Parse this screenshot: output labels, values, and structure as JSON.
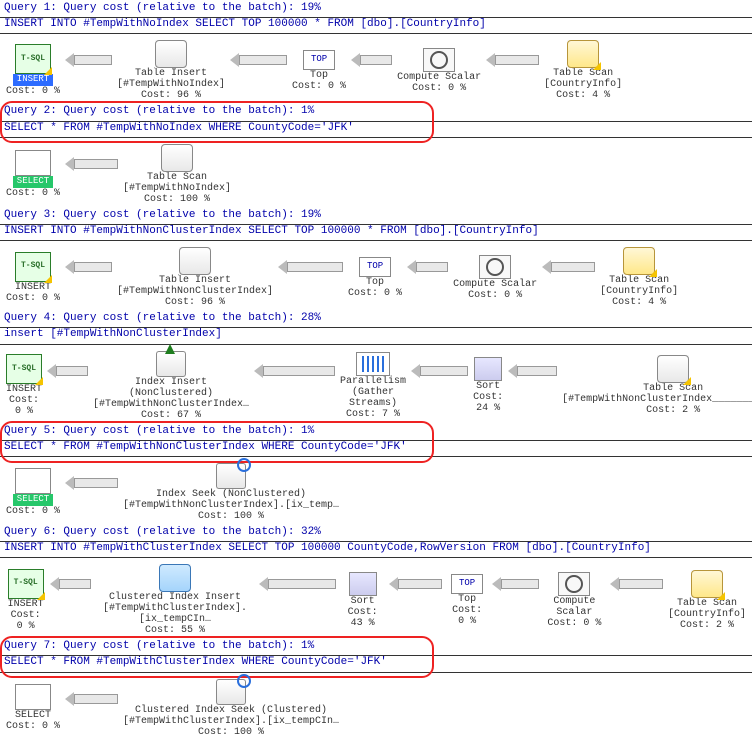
{
  "queries": [
    {
      "title": "Query 1: Query cost (relative to the batch): 19%",
      "sql": "INSERT INTO #TempWithNoIndex SELECT TOP 100000 * FROM [dbo].[CountryInfo]",
      "highlighted": false,
      "selected_style": "blue",
      "root_label": "INSERT",
      "root_cost": "Cost: 0 %",
      "root_warn": true,
      "ops": [
        {
          "name": "Table Insert",
          "sub": "[#TempWithNoIndex]",
          "cost": "Cost: 96 %",
          "icon": "cylinder",
          "arrow_w": 36
        },
        {
          "name": "Top",
          "sub": "",
          "cost": "Cost: 0 %",
          "icon": "pill-top",
          "arrow_w": 46
        },
        {
          "name": "Compute Scalar",
          "sub": "",
          "cost": "Cost: 0 %",
          "icon": "gear-box",
          "arrow_w": 30
        },
        {
          "name": "Table Scan",
          "sub": "[CountryInfo]",
          "cost": "Cost: 4 %",
          "icon": "cylinder-yellow",
          "arrow_w": 42,
          "warn": true
        }
      ]
    },
    {
      "title": "Query 2: Query cost (relative to the batch): 1%",
      "sql": "SELECT * FROM #TempWithNoIndex WHERE CountyCode='JFK'",
      "highlighted": true,
      "selected_style": "green",
      "root_label": "SELECT",
      "root_cost": "Cost: 0 %",
      "root_warn": false,
      "root_icon": "grid",
      "ops": [
        {
          "name": "Table Scan",
          "sub": "[#TempWithNoIndex]",
          "cost": "Cost: 100 %",
          "icon": "cylinder",
          "arrow_w": 42
        }
      ]
    },
    {
      "title": "Query 3: Query cost (relative to the batch): 19%",
      "sql": "INSERT INTO #TempWithNonClusterIndex SELECT TOP 100000 * FROM [dbo].[CountryInfo]",
      "highlighted": false,
      "root_label": "INSERT",
      "root_cost": "Cost: 0 %",
      "root_warn": true,
      "ops": [
        {
          "name": "Table Insert",
          "sub": "[#TempWithNonClusterIndex]",
          "cost": "Cost: 96 %",
          "icon": "cylinder",
          "arrow_w": 36
        },
        {
          "name": "Top",
          "sub": "",
          "cost": "Cost: 0 %",
          "icon": "pill-top",
          "arrow_w": 54
        },
        {
          "name": "Compute Scalar",
          "sub": "",
          "cost": "Cost: 0 %",
          "icon": "gear-box",
          "arrow_w": 30
        },
        {
          "name": "Table Scan",
          "sub": "[CountryInfo]",
          "cost": "Cost: 4 %",
          "icon": "cylinder-yellow",
          "arrow_w": 42,
          "warn": true
        }
      ]
    },
    {
      "title": "Query 4: Query cost (relative to the batch): 28%",
      "sql": "insert [#TempWithNonClusterIndex]",
      "highlighted": false,
      "root_label": "INSERT",
      "root_cost": "Cost: 0 %",
      "root_warn": true,
      "ops": [
        {
          "name": "Index Insert (NonClustered)",
          "sub": "[#TempWithNonClusterIndex…",
          "cost": "Cost: 67 %",
          "icon": "idx-cyl",
          "arrow_w": 30
        },
        {
          "name": "Parallelism",
          "sub": "(Gather Streams)",
          "cost": "Cost: 7 %",
          "icon": "parallel",
          "arrow_w": 70
        },
        {
          "name": "Sort",
          "sub": "",
          "cost": "Cost: 24 %",
          "icon": "sort",
          "arrow_w": 46
        },
        {
          "name": "Table Scan",
          "sub": "[#TempWithNonClusterIndex___________…",
          "cost": "Cost: 2 %",
          "icon": "cylinder",
          "arrow_w": 38,
          "warn": true
        }
      ]
    },
    {
      "title": "Query 5: Query cost (relative to the batch): 1%",
      "sql": "SELECT * FROM #TempWithNonClusterIndex WHERE CountyCode='JFK'",
      "highlighted": true,
      "selected_style": "green",
      "root_label": "SELECT",
      "root_cost": "Cost: 0 %",
      "root_warn": false,
      "root_icon": "grid",
      "ops": [
        {
          "name": "Index Seek (NonClustered)",
          "sub": "[#TempWithNonClusterIndex].[ix_temp…",
          "cost": "Cost: 100 %",
          "icon": "idx-seek",
          "arrow_w": 42
        }
      ]
    },
    {
      "title": "Query 6: Query cost (relative to the batch): 32%",
      "sql": "INSERT INTO #TempWithClusterIndex SELECT TOP 100000 CountyCode,RowVersion FROM [dbo].[CountryInfo]",
      "highlighted": false,
      "root_label": "INSERT",
      "root_cost": "Cost: 0 %",
      "root_warn": true,
      "ops": [
        {
          "name": "Clustered Index Insert",
          "sub": "[#TempWithClusterIndex].[ix_tempCIn…",
          "cost": "Cost: 55 %",
          "icon": "cyl-blue",
          "arrow_w": 30
        },
        {
          "name": "Sort",
          "sub": "",
          "cost": "Cost: 43 %",
          "icon": "sort",
          "arrow_w": 66
        },
        {
          "name": "Top",
          "sub": "",
          "cost": "Cost: 0 %",
          "icon": "pill-top",
          "arrow_w": 42
        },
        {
          "name": "Compute Scalar",
          "sub": "",
          "cost": "Cost: 0 %",
          "icon": "gear-box",
          "arrow_w": 36
        },
        {
          "name": "Table Scan",
          "sub": "[CountryInfo]",
          "cost": "Cost: 2 %",
          "icon": "cylinder-yellow",
          "arrow_w": 42,
          "warn": true
        }
      ]
    },
    {
      "title": "Query 7: Query cost (relative to the batch): 1%",
      "sql": "SELECT * FROM #TempWithClusterIndex WHERE CountyCode='JFK'",
      "highlighted": true,
      "root_label": "SELECT",
      "root_cost": "Cost: 0 %",
      "root_warn": false,
      "root_icon": "grid",
      "ops": [
        {
          "name": "Clustered Index Seek (Clustered)",
          "sub": "[#TempWithClusterIndex].[ix_tempCIn…",
          "cost": "Cost: 100 %",
          "icon": "idx-seek",
          "arrow_w": 42
        }
      ]
    }
  ]
}
